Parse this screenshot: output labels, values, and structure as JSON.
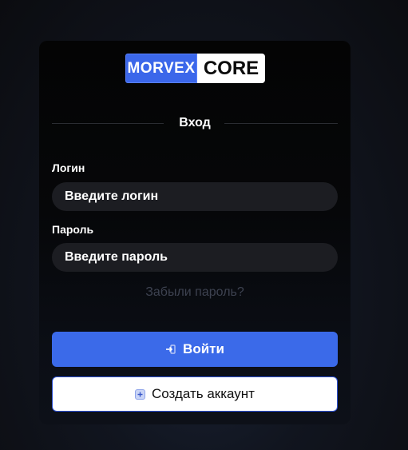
{
  "logo": {
    "left_text": "MORVEX",
    "right_text": "CORE"
  },
  "form": {
    "title": "Вход",
    "login": {
      "label": "Логин",
      "placeholder": "Введите логин",
      "value": ""
    },
    "password": {
      "label": "Пароль",
      "placeholder": "Введите пароль",
      "value": ""
    },
    "forgot_link": "Забыли пароль?",
    "login_button": "Войти",
    "register_button": "Создать аккаунт"
  },
  "icons": {
    "login_button_icon": "sign-in-icon",
    "register_button_icon": "plus-square-icon"
  },
  "colors": {
    "accent": "#3b6ae9",
    "card_bg": "#040404",
    "input_bg": "#1c1d22",
    "muted_link": "#3d4250"
  }
}
